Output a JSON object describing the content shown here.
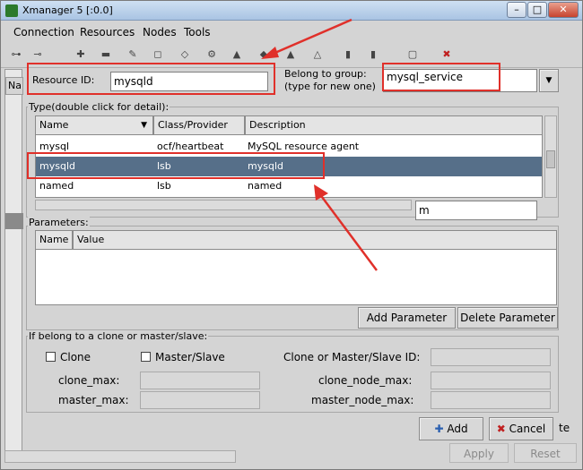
{
  "window": {
    "title": "Xmanager 5 [:0.0]"
  },
  "menu": [
    "Connection",
    "Resources",
    "Nodes",
    "Tools"
  ],
  "left_pane": {
    "header": "Na"
  },
  "resource": {
    "id_label": "Resource ID:",
    "id_value": "mysqld",
    "group_label_1": "Belong to group:",
    "group_label_2": "(type for new one)",
    "group_value": "mysql_service"
  },
  "type_table": {
    "title": "Type(double click for detail):",
    "columns": [
      "Name",
      "Class/Provider",
      "Description"
    ],
    "rows": [
      {
        "name": "mysql",
        "provider": "ocf/heartbeat",
        "description": "MySQL resource agent"
      },
      {
        "name": "mysqld",
        "provider": "lsb",
        "description": "mysqld"
      },
      {
        "name": "named",
        "provider": "lsb",
        "description": "named"
      }
    ],
    "filter_value": "m"
  },
  "parameters": {
    "title": "Parameters:",
    "columns": [
      "Name",
      "Value"
    ],
    "add_button": "Add Parameter",
    "delete_button": "Delete Parameter"
  },
  "clone": {
    "title": "If belong to a clone or master/slave:",
    "clone_label": "Clone",
    "masterslave_label": "Master/Slave",
    "clone_ms_id_label": "Clone or Master/Slave ID:",
    "clone_max_label": "clone_max:",
    "clone_node_max_label": "clone_node_max:",
    "master_max_label": "master_max:",
    "master_node_max_label": "master_node_max:"
  },
  "buttons": {
    "add": "Add",
    "cancel": "Cancel",
    "apply": "Apply",
    "reset": "Reset",
    "partial": "te"
  },
  "colors": {
    "highlight": "#e0302a",
    "selected_row": "#566f89"
  }
}
